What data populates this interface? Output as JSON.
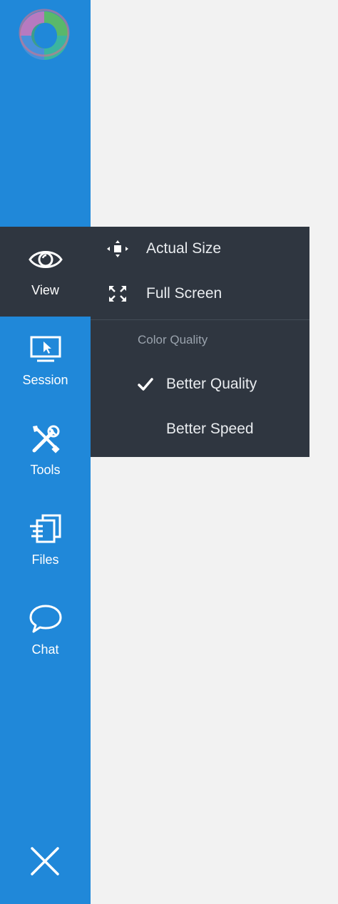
{
  "colors": {
    "sidebar": "#2088d9",
    "active_bg": "#2f3640",
    "menu_bg": "#2f3640",
    "menu_text": "#e9ecef",
    "section_label": "#9aa3ad",
    "content_bg": "#f2f2f2"
  },
  "sidebar": {
    "logo_icon": "ring-logo-icon",
    "items": [
      {
        "label": "View",
        "icon": "eye-icon",
        "active": true
      },
      {
        "label": "Session",
        "icon": "monitor-cursor-icon",
        "active": false
      },
      {
        "label": "Tools",
        "icon": "tools-icon",
        "active": false
      },
      {
        "label": "Files",
        "icon": "files-icon",
        "active": false
      },
      {
        "label": "Chat",
        "icon": "chat-bubble-icon",
        "active": false
      }
    ],
    "close_icon": "close-icon"
  },
  "view_menu": {
    "items": [
      {
        "label": "Actual Size",
        "icon": "actual-size-icon"
      },
      {
        "label": "Full Screen",
        "icon": "full-screen-icon"
      }
    ],
    "color_quality": {
      "label": "Color Quality",
      "options": [
        {
          "label": "Better Quality",
          "selected": true
        },
        {
          "label": "Better Speed",
          "selected": false
        }
      ]
    }
  }
}
